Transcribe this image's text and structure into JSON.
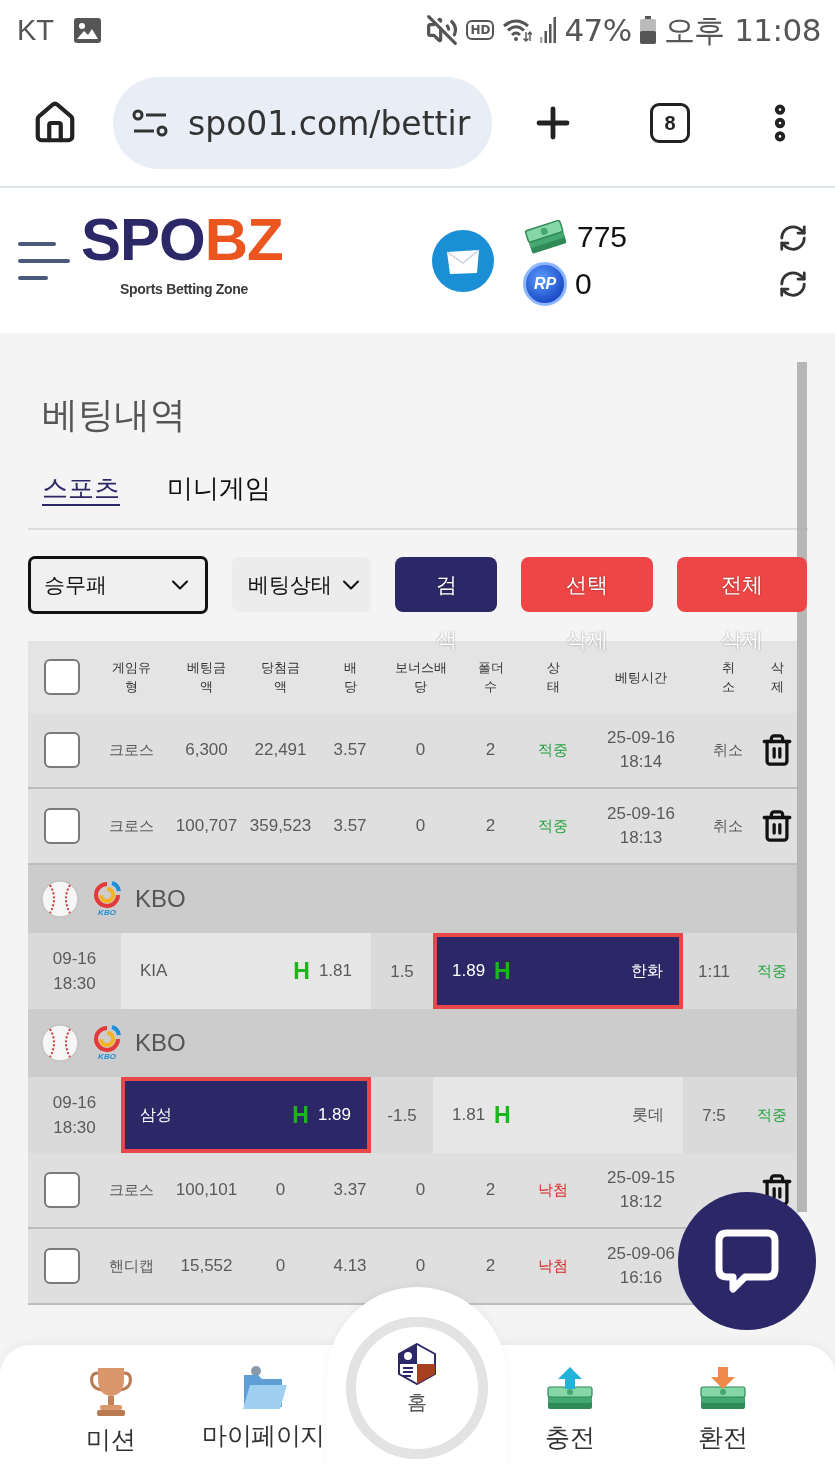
{
  "status_bar": {
    "carrier": "KT",
    "hd_badge": "HD",
    "battery": "47%",
    "time": "오후 11:08"
  },
  "browser_bar": {
    "url": "spo01.com/bettir",
    "tab_count": "8"
  },
  "header": {
    "logo": {
      "primary": "SPO",
      "accent": "BZ",
      "tagline": "Sports Betting Zone"
    },
    "balances": [
      {
        "kind": "cash",
        "amount": "775"
      },
      {
        "kind": "points",
        "badge": "RP",
        "amount": "0"
      }
    ]
  },
  "page_title": "베팅내역",
  "tabs": [
    {
      "label": "스포츠",
      "selected": true
    },
    {
      "label": "미니게임",
      "selected": false
    }
  ],
  "filters": {
    "selects": [
      {
        "value": "승무패",
        "focused": true
      },
      {
        "value": "베팅상태",
        "focused": false
      }
    ],
    "buttons": [
      {
        "label": "검색",
        "kind": "primary"
      },
      {
        "label": "선택삭제",
        "kind": "danger"
      },
      {
        "label": "전체삭제",
        "kind": "danger"
      }
    ]
  },
  "table": {
    "select_all": {
      "checked": false
    },
    "columns": [
      "게임유형",
      "베팅금액",
      "당첨금액",
      "배당",
      "보너스배당",
      "폴더수",
      "상태",
      "베팅시간",
      "취소",
      "삭제"
    ],
    "rows": [
      {
        "kind": "bet",
        "checked": false,
        "game_type": "크로스",
        "stake": "6,300",
        "payout": "22,491",
        "odds": "3.57",
        "bonus_odds": "0",
        "folders": "2",
        "status": "적중",
        "color": "#23a23f",
        "bet_time": "25-09-16 18:14",
        "cancel": "취소",
        "deletable": true
      },
      {
        "kind": "bet",
        "checked": false,
        "game_type": "크로스",
        "stake": "100,707",
        "payout": "359,523",
        "odds": "3.57",
        "bonus_odds": "0",
        "folders": "2",
        "status": "적중",
        "color": "#23a23f",
        "bet_time": "25-09-16 18:13",
        "cancel": "취소",
        "deletable": true
      },
      {
        "kind": "league",
        "name": "KBO",
        "logo_caption": "KBO"
      },
      {
        "kind": "match",
        "date": "09-16",
        "time": "18:30",
        "home": {
          "team": "KIA",
          "marker": "H",
          "odds": "1.81",
          "selected": false
        },
        "line": "1.5",
        "away": {
          "team": "한화",
          "marker": "H",
          "odds": "1.89",
          "selected": true
        },
        "score": "1:11",
        "status": "적중",
        "color": "#23a23f"
      },
      {
        "kind": "league",
        "name": "KBO",
        "logo_caption": "KBO"
      },
      {
        "kind": "match",
        "date": "09-16",
        "time": "18:30",
        "home": {
          "team": "삼성",
          "marker": "H",
          "odds": "1.89",
          "selected": true
        },
        "line": "-1.5",
        "away": {
          "team": "롯데",
          "marker": "H",
          "odds": "1.81",
          "selected": false
        },
        "score": "7:5",
        "status": "적중",
        "color": "#23a23f"
      },
      {
        "kind": "bet",
        "checked": false,
        "game_type": "크로스",
        "stake": "100,101",
        "payout": "0",
        "odds": "3.37",
        "bonus_odds": "0",
        "folders": "2",
        "status": "낙첨",
        "color": "#d62828",
        "bet_time": "25-09-15 18:12",
        "deletable": true
      },
      {
        "kind": "bet",
        "checked": false,
        "game_type": "핸디캡",
        "stake": "15,552",
        "payout": "0",
        "odds": "4.13",
        "bonus_odds": "0",
        "folders": "2",
        "status": "낙첨",
        "color": "#d62828",
        "bet_time": "25-09-06 16:16",
        "deletable": false
      }
    ]
  },
  "bottom_nav": [
    {
      "kind": "mission",
      "label": "미션"
    },
    {
      "kind": "mypage",
      "label": "마이페이지"
    },
    {
      "kind": "home",
      "label": "홈"
    },
    {
      "kind": "deposit",
      "label": "충전"
    },
    {
      "kind": "withdraw",
      "label": "환전"
    }
  ]
}
